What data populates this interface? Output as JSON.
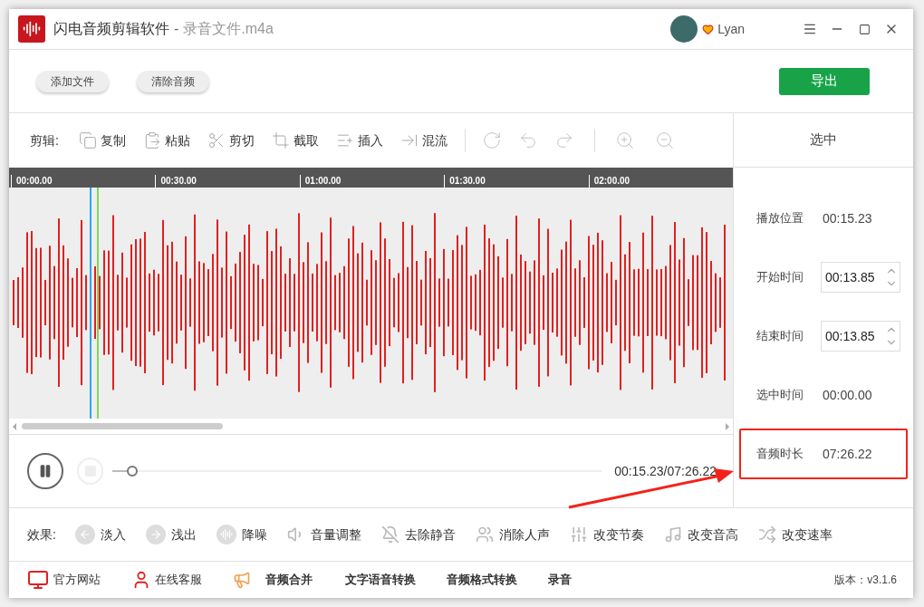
{
  "window": {
    "app_name": "闪电音频剪辑软件",
    "separator": "-",
    "file_name": "录音文件.m4a",
    "user": "Lyan"
  },
  "top_buttons": [
    "添加文件",
    "清除音频"
  ],
  "export_button": "导出",
  "edit_toolbar": {
    "label": "剪辑:",
    "tools": [
      {
        "kind": "copy",
        "label": "复制"
      },
      {
        "kind": "paste",
        "label": "粘贴"
      },
      {
        "kind": "cut",
        "label": "剪切"
      },
      {
        "kind": "crop",
        "label": "截取"
      },
      {
        "kind": "insert",
        "label": "插入"
      },
      {
        "kind": "mix",
        "label": "混流"
      }
    ]
  },
  "ruler": [
    "00:00.00",
    "00:30.00",
    "01:00.00",
    "01:30.00",
    "02:00.00"
  ],
  "side_panel": {
    "title": "选中",
    "rows": [
      {
        "kind": "text",
        "label": "播放位置",
        "value": "00:15.23"
      },
      {
        "kind": "spin",
        "label": "开始时间",
        "value": "00:13.85"
      },
      {
        "kind": "spin",
        "label": "结束时间",
        "value": "00:13.85"
      },
      {
        "kind": "text",
        "label": "选中时间",
        "value": "00:00.00"
      },
      {
        "kind": "text",
        "label": "音频时长",
        "value": "07:26.22",
        "highlighted": true
      }
    ]
  },
  "player": {
    "playing": true,
    "level": 0.04,
    "time": "00:15.23/07:26.22"
  },
  "effects": {
    "label": "效果:",
    "items": [
      {
        "kind": "fadein",
        "label": "淡入"
      },
      {
        "kind": "fadeout",
        "label": "浅出"
      },
      {
        "kind": "denoise",
        "label": "降噪"
      },
      {
        "kind": "volume",
        "label": "音量调整"
      },
      {
        "kind": "mute",
        "label": "去除静音"
      },
      {
        "kind": "voice",
        "label": "消除人声"
      },
      {
        "kind": "tempo",
        "label": "改变节奏"
      },
      {
        "kind": "pitch",
        "label": "改变音高"
      },
      {
        "kind": "rate",
        "label": "改变速率"
      }
    ]
  },
  "footer": {
    "links": [
      {
        "kind": "site",
        "label": "官方网站"
      },
      {
        "kind": "service",
        "label": "在线客服"
      },
      {
        "kind": "merge",
        "label": "音频合并"
      },
      {
        "kind": "plain",
        "label": "文字语音转换"
      },
      {
        "kind": "plain",
        "label": "音频格式转换"
      },
      {
        "kind": "plain",
        "label": "录音"
      }
    ],
    "version": "版本：v3.1.6"
  }
}
